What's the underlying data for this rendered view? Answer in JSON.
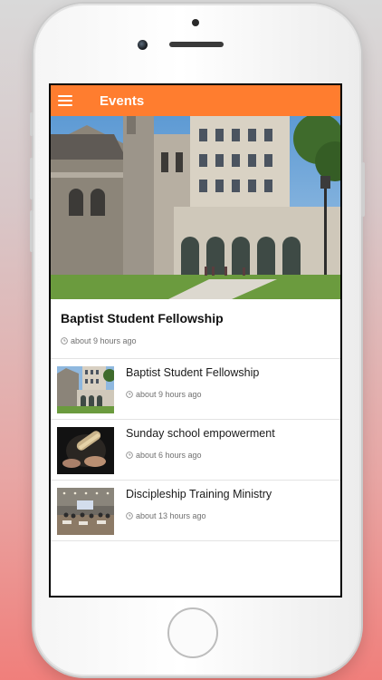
{
  "app_bar": {
    "title": "Events",
    "menu_icon": "hamburger-menu-icon",
    "color": "#ff7d2f"
  },
  "featured": {
    "title": "Baptist Student Fellowship",
    "time": "about 9 hours ago",
    "icon": "clock-icon"
  },
  "events": [
    {
      "title": "Baptist Student Fellowship",
      "time": "about 9 hours ago"
    },
    {
      "title": "Sunday school empowerment",
      "time": "about 6 hours ago"
    },
    {
      "title": "Discipleship Training Ministry",
      "time": "about 13 hours ago"
    }
  ]
}
